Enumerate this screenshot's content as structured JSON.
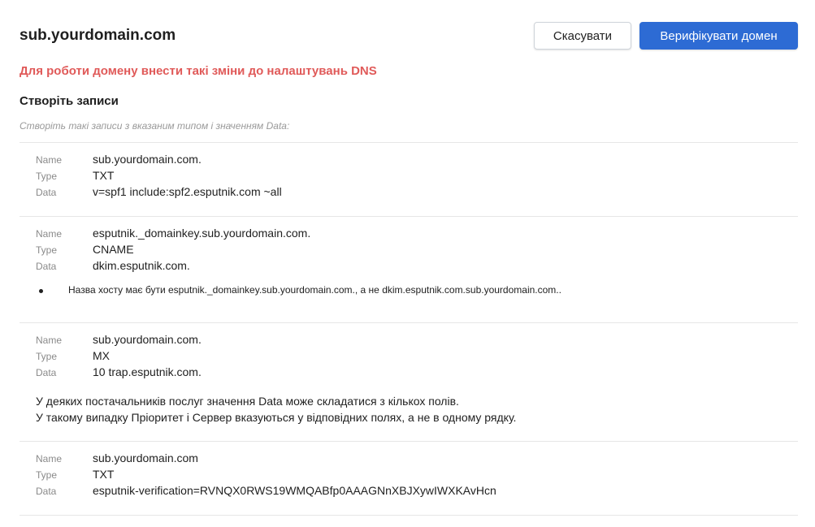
{
  "header": {
    "domain": "sub.yourdomain.com",
    "cancel_label": "Скасувати",
    "verify_label": "Верифікувати домен"
  },
  "warning": "Для роботи домену внести такі зміни до налаштувань DNS",
  "section_title": "Створіть записи",
  "hint": "Створіть такі записи з вказаним типом і значенням Data:",
  "labels": {
    "name": "Name",
    "type": "Type",
    "data": "Data"
  },
  "records": [
    {
      "name": "sub.yourdomain.com.",
      "type": "TXT",
      "data": "v=spf1 include:spf2.esputnik.com ~all"
    },
    {
      "name": "esputnik._domainkey.sub.yourdomain.com.",
      "type": "CNAME",
      "data": "dkim.esputnik.com.",
      "bullet": "Назва хосту має бути esputnik._domainkey.sub.yourdomain.com., а не dkim.esputnik.com.sub.yourdomain.com.."
    },
    {
      "name": "sub.yourdomain.com.",
      "type": "MX",
      "data": "10 trap.esputnik.com.",
      "note_line1": "У деяких постачальників послуг значення Data може складатися з кількох полів.",
      "note_line2": "У такому випадку Пріоритет і Сервер вказуються у відповідних полях, а не в одному рядку."
    },
    {
      "name": "sub.yourdomain.com",
      "type": "TXT",
      "data": "esputnik-verification=RVNQX0RWS19WMQABfp0AAAGNnXBJXywIWXKAvHcn"
    }
  ]
}
